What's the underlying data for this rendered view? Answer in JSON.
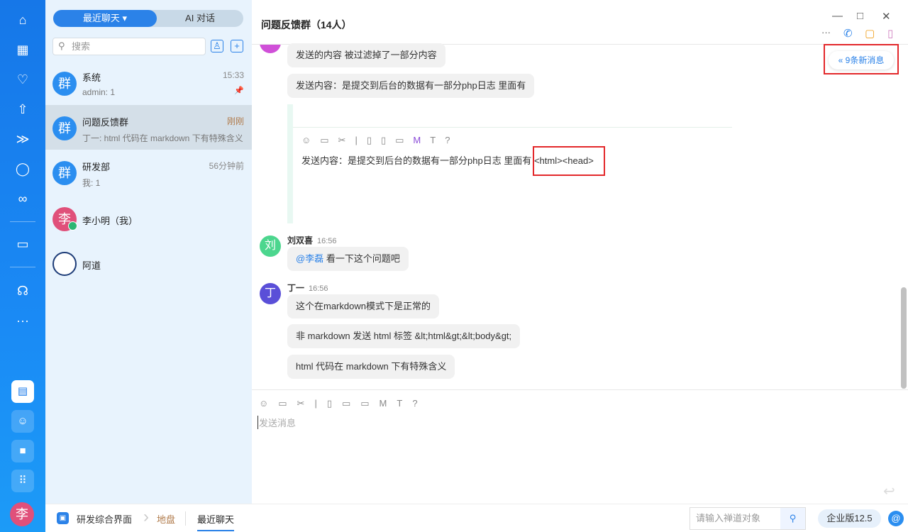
{
  "rail": {
    "user_avatar": "李",
    "icons": [
      "home-icon",
      "apps-icon",
      "bulb-icon",
      "rocket-icon",
      "run-icon",
      "search-icon",
      "infinity-icon",
      "board-icon",
      "robot-icon",
      "more-icon"
    ]
  },
  "list": {
    "tab_recent": "最近聊天",
    "tab_ai": "AI 对话",
    "search_placeholder": "搜索",
    "items": [
      {
        "avatar": "群",
        "name": "系统",
        "preview": "admin: 1",
        "time": "15:33"
      },
      {
        "avatar": "群",
        "name": "问题反馈群",
        "preview": "丁一: html 代码在 markdown 下有特殊含义",
        "time": "刚刚"
      },
      {
        "avatar": "群",
        "name": "研发部",
        "preview": "我: 1",
        "time": "56分钟前"
      },
      {
        "avatar": "李",
        "name": "李小明（我）"
      },
      {
        "avatar": "",
        "name": "阿道"
      }
    ]
  },
  "chat": {
    "title": "问题反馈群（14人）",
    "new_messages": "9条新消息",
    "messages": [
      {
        "text": "发送的内容 被过滤掉了一部分内容"
      },
      {
        "text": "发送内容：是提交到后台的数据有一部分php日志 里面有"
      },
      {
        "text": "发送内容：是提交到后台的数据有一部分php日志 里面有",
        "highlight": "<html><head>"
      },
      {
        "avatar": "刘",
        "sender": "刘双喜",
        "time": "16:56",
        "mention": "@李磊",
        "text": " 看一下这个问题吧"
      },
      {
        "avatar": "丁",
        "sender": "丁一",
        "time": "16:56",
        "text": "这个在markdown模式下是正常的"
      },
      {
        "text": "非 markdown 发送 html 标签 &lt;html&gt;&lt;body&gt;"
      },
      {
        "text": "html 代码在 markdown 下有特殊含义"
      }
    ],
    "input_placeholder": "发送消息"
  },
  "bottom": {
    "crumbs": [
      "研发综合界面",
      "地盘",
      "最近聊天"
    ],
    "search_placeholder": "请输入禅道对象",
    "version": "企业版12.5"
  }
}
